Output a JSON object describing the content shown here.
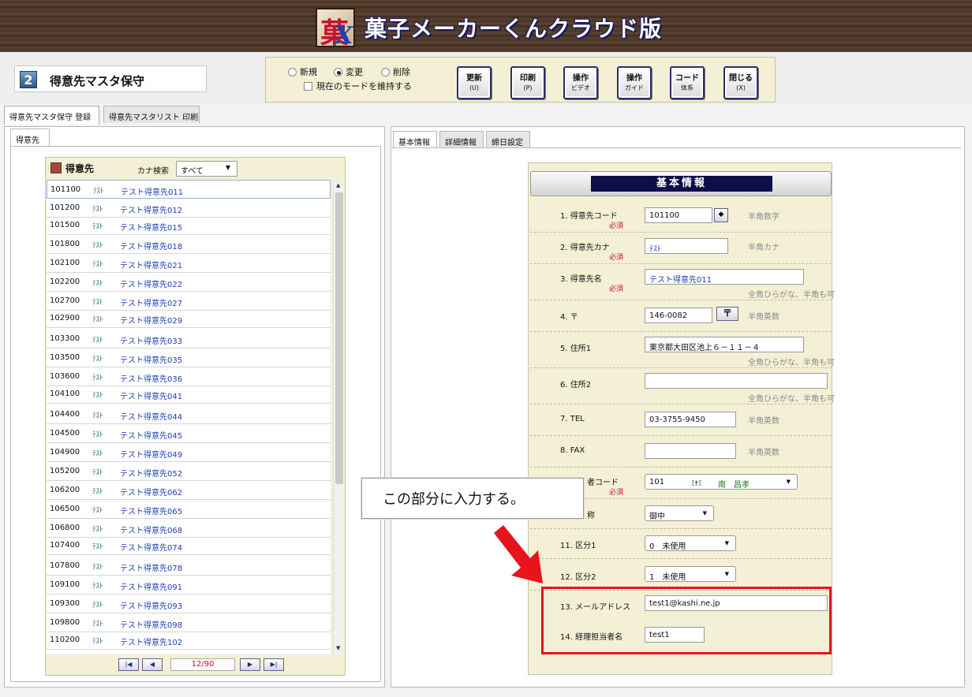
{
  "app": {
    "title": "菓子メーカーくんクラウド版"
  },
  "screen": {
    "number": "2",
    "title": "得意先マスタ保守"
  },
  "mode": {
    "options": [
      "新規",
      "変更",
      "削除"
    ],
    "selected": "変更",
    "keep_mode_label": "現在のモードを維持する"
  },
  "toolbar": {
    "buttons": [
      {
        "label": "更新",
        "key": "(U)"
      },
      {
        "label": "印刷",
        "key": "(P)"
      },
      {
        "label": "操作",
        "key": "ビデオ"
      },
      {
        "label": "操作",
        "key": "ガイド"
      },
      {
        "label": "コード",
        "key": "体系"
      },
      {
        "label": "閉じる",
        "key": "(X)"
      }
    ]
  },
  "main_tabs": [
    "得意先マスタ保守 登録",
    "得意先マスタリスト 印刷"
  ],
  "left": {
    "subtab": "得意先",
    "list_title": "得意先",
    "kana_search_label": "カナ検索",
    "kana_search_value": "すべて",
    "rows": [
      {
        "code": "101100",
        "kana": "ﾃｽﾄ",
        "name": "テスト得意先011"
      },
      {
        "code": "101200",
        "kana": "ﾃｽﾄ",
        "name": "テスト得意先012"
      },
      {
        "code": "101500",
        "kana": "ﾃｽﾄ",
        "name": "テスト得意先015"
      },
      {
        "code": "101800",
        "kana": "ﾃｽﾄ",
        "name": "テスト得意先018"
      },
      {
        "code": "102100",
        "kana": "ﾃｽﾄ",
        "name": "テスト得意先021"
      },
      {
        "code": "102200",
        "kana": "ﾃｽﾄ",
        "name": "テスト得意先022"
      },
      {
        "code": "102700",
        "kana": "ﾃｽﾄ",
        "name": "テスト得意先027"
      },
      {
        "code": "102900",
        "kana": "ﾃｽﾄ",
        "name": "テスト得意先029"
      },
      {
        "code": "103300",
        "kana": "ﾃｽﾄ",
        "name": "テスト得意先033"
      },
      {
        "code": "103500",
        "kana": "ﾃｽﾄ",
        "name": "テスト得意先035"
      },
      {
        "code": "103600",
        "kana": "ﾃｽﾄ",
        "name": "テスト得意先036"
      },
      {
        "code": "104100",
        "kana": "ﾃｽﾄ",
        "name": "テスト得意先041"
      },
      {
        "code": "104400",
        "kana": "ﾃｽﾄ",
        "name": "テスト得意先044"
      },
      {
        "code": "104500",
        "kana": "ﾃｽﾄ",
        "name": "テスト得意先045"
      },
      {
        "code": "104900",
        "kana": "ﾃｽﾄ",
        "name": "テスト得意先049"
      },
      {
        "code": "105200",
        "kana": "ﾃｽﾄ",
        "name": "テスト得意先052"
      },
      {
        "code": "106200",
        "kana": "ﾃｽﾄ",
        "name": "テスト得意先062"
      },
      {
        "code": "106500",
        "kana": "ﾃｽﾄ",
        "name": "テスト得意先065"
      },
      {
        "code": "106800",
        "kana": "ﾃｽﾄ",
        "name": "テスト得意先068"
      },
      {
        "code": "107400",
        "kana": "ﾃｽﾄ",
        "name": "テスト得意先074"
      },
      {
        "code": "107800",
        "kana": "ﾃｽﾄ",
        "name": "テスト得意先078"
      },
      {
        "code": "109100",
        "kana": "ﾃｽﾄ",
        "name": "テスト得意先091"
      },
      {
        "code": "109300",
        "kana": "ﾃｽﾄ",
        "name": "テスト得意先093"
      },
      {
        "code": "109800",
        "kana": "ﾃｽﾄ",
        "name": "テスト得意先098"
      },
      {
        "code": "110200",
        "kana": "ﾃｽﾄ",
        "name": "テスト得意先102"
      }
    ],
    "pager": {
      "first": "|◀",
      "prev": "◀",
      "next": "▶",
      "last": "▶|",
      "indicator": "12/90"
    }
  },
  "right": {
    "tabs": [
      "基本情報",
      "詳細情報",
      "締日設定"
    ],
    "header": "基本情報",
    "fields": {
      "f1_label": "1. 得意先コード",
      "f1_value": "101100",
      "f1_hint": "半角数字",
      "f2_label": "2. 得意先カナ",
      "f2_value": "ﾃｽﾄ",
      "f2_hint": "半角カナ",
      "f3_label": "3. 得意先名",
      "f3_value": "テスト得意先011",
      "f3_hint": "全角ひらがな、半角も可",
      "f4_label": "4. 〒",
      "f4_value": "146-0082",
      "f4_hint": "半角英数",
      "f5_label": "5. 住所1",
      "f5_value": "東京都大田区池上６－１１－４",
      "f5_hint": "全角ひらがな、半角も可",
      "f6_label": "6. 住所2",
      "f6_value": "",
      "f6_hint": "全角ひらがな、半角も可",
      "f7_label": "7. TEL",
      "f7_value": "03-3755-9450",
      "f7_hint": "半角英数",
      "f8_label": "8. FAX",
      "f8_value": "",
      "f8_hint": "半角英数",
      "f9_label": "者コード",
      "f9_code": "101",
      "f9_kana": "ﾐﾅﾐ",
      "f9_name": "南　昌孝",
      "f10_label": "称",
      "f10_value": "御中",
      "f11_label": "11. 区分1",
      "f11_value": "0　未使用",
      "f12_label": "12. 区分2",
      "f12_value": "1　未使用",
      "f13_label": "13. メールアドレス",
      "f13_value": "test1@kashi.ne.jp",
      "f14_label": "14. 経理担当者名",
      "f14_value": "test1",
      "required": "必須"
    }
  },
  "callout": {
    "text": "この部分に入力する。"
  },
  "colors": {
    "highlight": "#e8141b",
    "header_navy": "#0d0d4a",
    "form_bg": "#f4f0d6"
  }
}
